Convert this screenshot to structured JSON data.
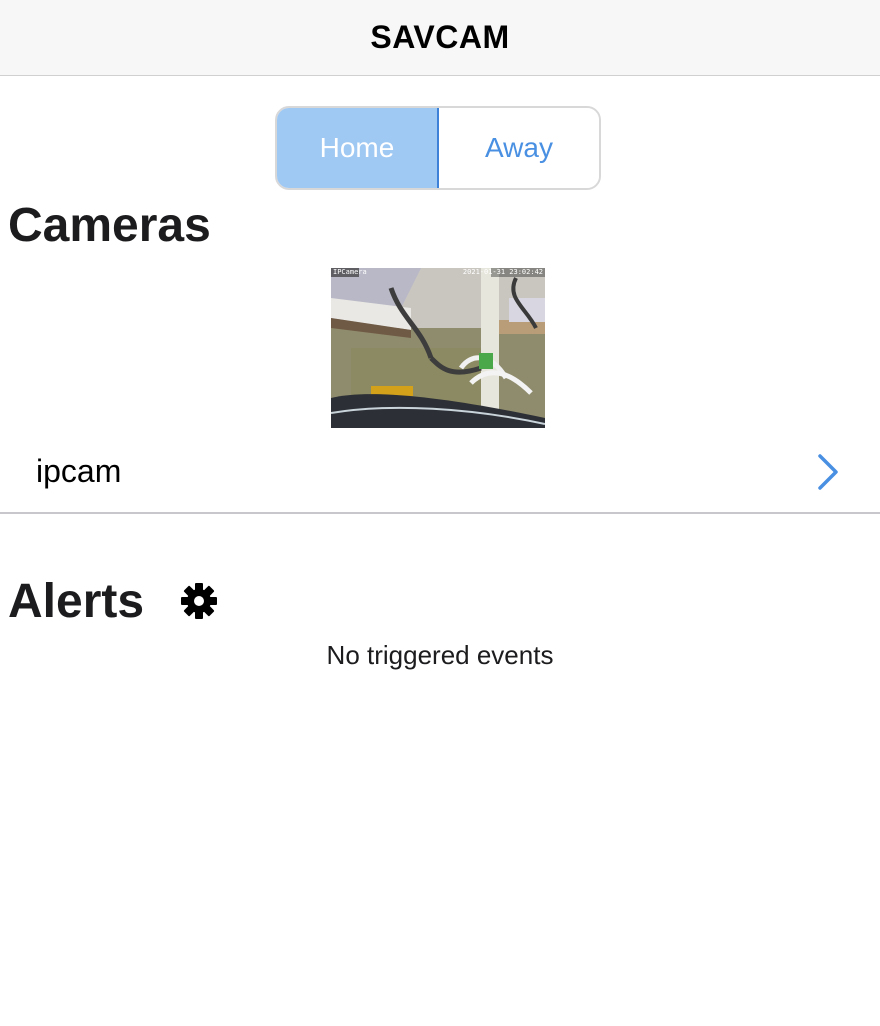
{
  "nav": {
    "title": "SAVCAM"
  },
  "mode_switch": {
    "options": [
      "Home",
      "Away"
    ],
    "selected": "Home"
  },
  "cameras": {
    "heading": "Cameras",
    "items": [
      {
        "name": "ipcam",
        "thumbnail_overlay_left": "IPCamera",
        "thumbnail_overlay_right": "2021-01-31 23:02:42"
      }
    ]
  },
  "alerts": {
    "heading": "Alerts",
    "empty_message": "No triggered events"
  },
  "icons": {
    "settings": "gear-icon",
    "disclosure": "chevron-right-icon"
  },
  "colors": {
    "accent": "#4a90e2",
    "segment_selected_bg": "#9fc8f3",
    "segment_selected_border": "#3d82d8"
  }
}
